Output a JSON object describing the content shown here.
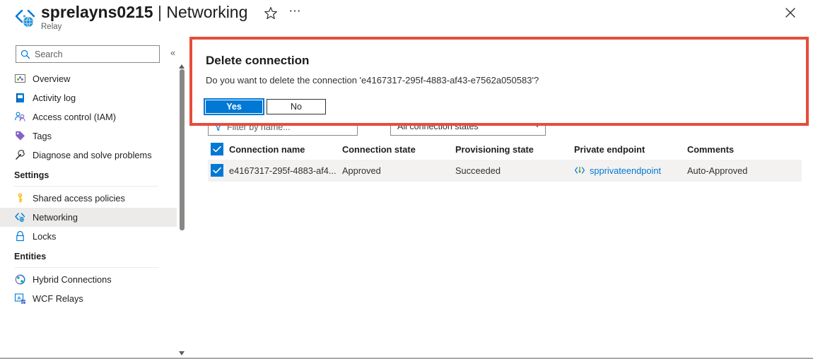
{
  "header": {
    "resource_icon": "relay-networking-icon",
    "title_resource": "sprelayns0215",
    "title_separator": "|",
    "title_page": "Networking",
    "subtitle": "Relay",
    "favorite_icon": "star-icon",
    "more_icon": "ellipsis-icon",
    "close_icon": "close-icon"
  },
  "sidebar": {
    "search": {
      "placeholder": "Search",
      "value": "",
      "icon": "search-icon"
    },
    "collapse_icon": "chevron-double-left-icon",
    "items": [
      {
        "label": "Overview",
        "icon": "overview-icon",
        "selected": false
      },
      {
        "label": "Activity log",
        "icon": "activity-log-icon",
        "selected": false
      },
      {
        "label": "Access control (IAM)",
        "icon": "access-control-icon",
        "selected": false
      },
      {
        "label": "Tags",
        "icon": "tags-icon",
        "selected": false
      },
      {
        "label": "Diagnose and solve problems",
        "icon": "wrench-icon",
        "selected": false
      }
    ],
    "group_settings": "Settings",
    "settings_items": [
      {
        "label": "Shared access policies",
        "icon": "key-icon",
        "selected": false
      },
      {
        "label": "Networking",
        "icon": "networking-icon",
        "selected": true
      },
      {
        "label": "Locks",
        "icon": "lock-icon",
        "selected": false
      }
    ],
    "group_entities": "Entities",
    "entities_items": [
      {
        "label": "Hybrid Connections",
        "icon": "hybrid-connections-icon",
        "selected": false
      },
      {
        "label": "WCF Relays",
        "icon": "wcf-relays-icon",
        "selected": false
      }
    ]
  },
  "toolbar": {
    "filter_placeholder": "Filter by name...",
    "filter_value": "",
    "filter_icon": "filter-icon",
    "state_select_value": "All connection states",
    "state_select_chevron": "chevron-down-icon"
  },
  "table": {
    "columns": [
      "Connection name",
      "Connection state",
      "Provisioning state",
      "Private endpoint",
      "Comments"
    ],
    "select_all_checked": true,
    "rows": [
      {
        "checked": true,
        "connection_name": "e4167317-295f-4883-af4...",
        "connection_state": "Approved",
        "provisioning_state": "Succeeded",
        "private_endpoint": "spprivateendpoint",
        "private_endpoint_icon": "private-endpoint-icon",
        "comments": "Auto-Approved"
      }
    ]
  },
  "dialog": {
    "title": "Delete connection",
    "message": "Do you want to delete the connection 'e4167317-295f-4883-af43-e7562a050583'?",
    "yes_label": "Yes",
    "no_label": "No",
    "highlight_color": "#e74c3c",
    "primary_color": "#0078d4"
  }
}
